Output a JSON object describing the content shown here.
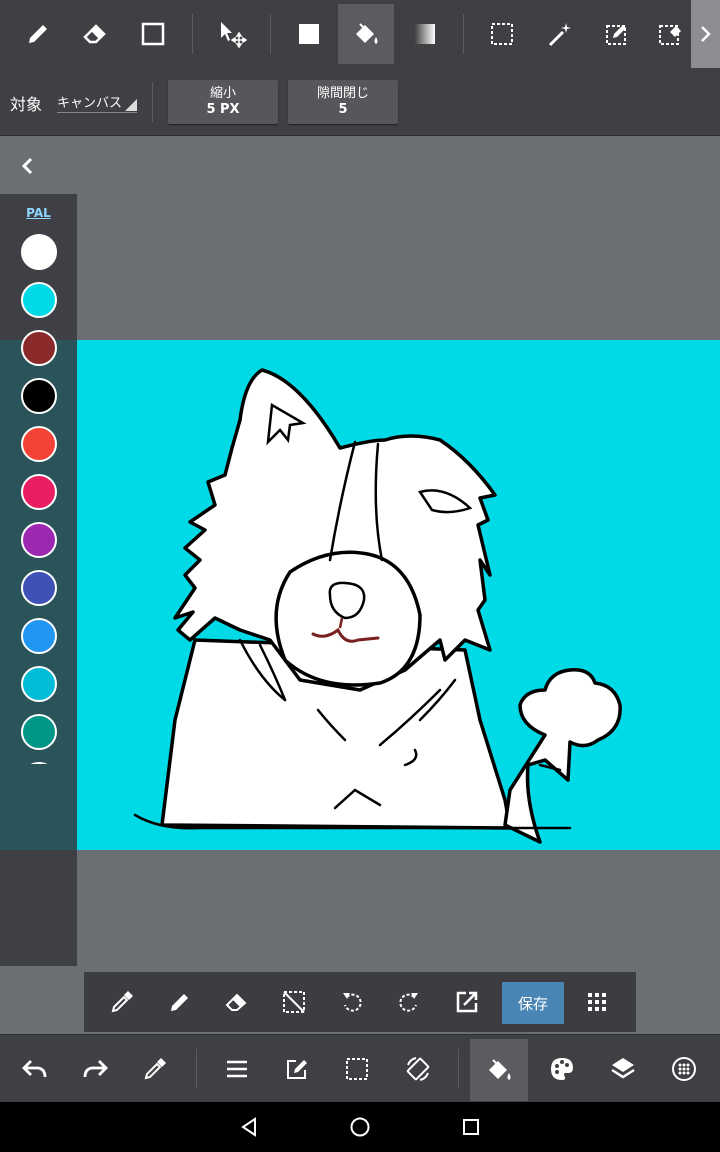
{
  "top_toolbar": {
    "tools": [
      "pen-icon",
      "eraser-icon",
      "rectangle-shape-icon",
      "move-transform-icon",
      "fill-square-icon",
      "bucket-fill-icon",
      "gradient-icon",
      "rect-select-icon",
      "magic-wand-icon",
      "select-pen-icon",
      "select-eraser-icon"
    ],
    "active_tool": "bucket-fill-icon"
  },
  "options": {
    "target_label": "対象",
    "target_value": "キャンバス",
    "shrink_label": "縮小",
    "shrink_value": "5 PX",
    "gap_label": "隙間閉じ",
    "gap_value": "5"
  },
  "palette": {
    "tab_label": "PAL",
    "colors": [
      "#ffffff",
      "#00d9e6",
      "#8b2a2a",
      "#000000",
      "#f44336",
      "#e91e63",
      "#9c27b0",
      "#3f51b5",
      "#2196f3",
      "#00bcd4",
      "#009688",
      "#4caf50"
    ]
  },
  "canvas": {
    "background": "#00d9e6"
  },
  "float_toolbar": {
    "tools": [
      "eyedropper-icon",
      "pen-icon",
      "eraser-icon",
      "deselect-icon",
      "rotate-left-icon",
      "rotate-right-icon",
      "export-icon"
    ],
    "save_label": "保存",
    "more": "grid-icon"
  },
  "bottom_toolbar": {
    "tools": [
      "undo-icon",
      "redo-icon",
      "eyedropper-icon",
      "menu-icon",
      "edit-icon",
      "select-icon",
      "rotate-view-icon",
      "bucket-fill-icon",
      "palette-icon",
      "layers-icon",
      "brush-size-icon"
    ],
    "active_tool": "bucket-fill-icon"
  },
  "nav": [
    "back-icon",
    "home-icon",
    "recents-icon"
  ]
}
